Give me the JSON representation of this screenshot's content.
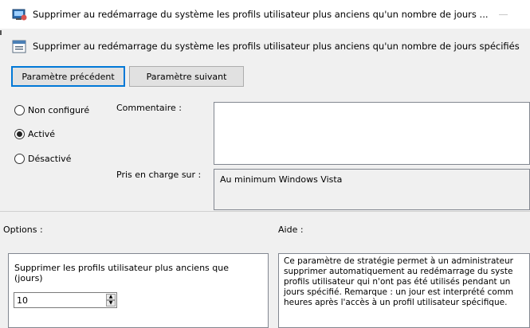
{
  "window": {
    "title": "Supprimer au redémarrage du système les profils utilisateur plus anciens qu'un nombre de jours ..."
  },
  "header": {
    "policy_name": "Supprimer au redémarrage du système les profils utilisateur plus anciens qu'un nombre de jours spécifiés"
  },
  "toolbar": {
    "prev_label": "Paramètre précédent",
    "next_label": "Paramètre suivant"
  },
  "state": {
    "options": [
      {
        "label": "Non configuré",
        "checked": false
      },
      {
        "label": "Activé",
        "checked": true
      },
      {
        "label": "Désactivé",
        "checked": false
      }
    ]
  },
  "comment": {
    "label": "Commentaire :",
    "value": ""
  },
  "supported": {
    "label": "Pris en charge sur :",
    "value": "Au minimum Windows Vista"
  },
  "options_section": {
    "label": "Options :",
    "field_label_line1": "Supprimer les profils utilisateur plus anciens que",
    "field_label_line2": "(jours)",
    "days_value": "10"
  },
  "help_section": {
    "label": "Aide :",
    "lines": [
      "Ce paramètre de stratégie permet à un administrateur",
      "supprimer automatiquement au redémarrage du syste",
      "profils utilisateur qui n'ont pas été utilisés pendant un",
      "jours spécifié. Remarque : un jour est interprété comm",
      "heures après l'accès à un profil utilisateur spécifique."
    ]
  },
  "colors": {
    "accent": "#0078d7",
    "window_bg": "#f0f0f0"
  },
  "icons": [
    "policy-window-icon",
    "policy-setting-icon",
    "spin-up-icon",
    "spin-down-icon"
  ]
}
